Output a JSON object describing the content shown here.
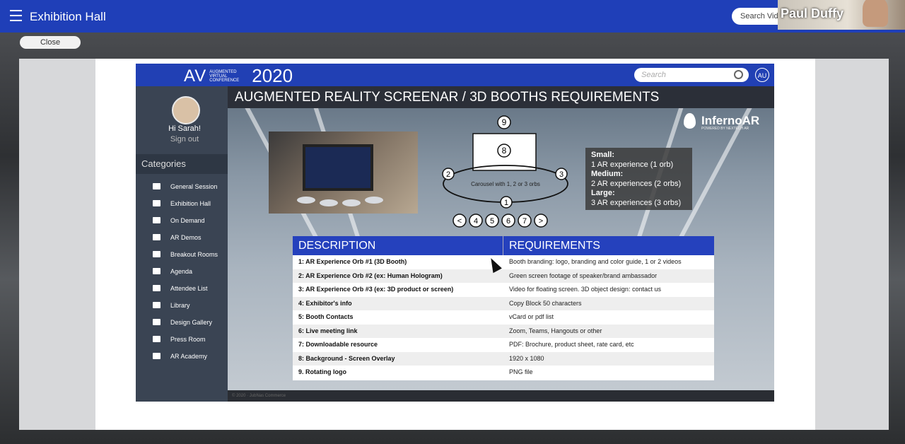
{
  "topbar": {
    "title": "Exhibition Hall",
    "search_placeholder": "Search Vid"
  },
  "camera": {
    "name": "Paul Duffy"
  },
  "close_label": "Close",
  "inner": {
    "logo_av": "AV",
    "logo_small": "AUGMENTED VIRTUAL CONFERENCE",
    "logo_year": "2020",
    "search_placeholder": "Search",
    "avatar_initials": "AU",
    "greeting": "Hi Sarah!",
    "signout": "Sign out",
    "categories_label": "Categories",
    "nav": [
      {
        "label": "General Session",
        "icon": "person-icon"
      },
      {
        "label": "Exhibition Hall",
        "icon": "booth-icon"
      },
      {
        "label": "On Demand",
        "icon": "screen-icon"
      },
      {
        "label": "AR Demos",
        "icon": "headset-icon"
      },
      {
        "label": "Breakout Rooms",
        "icon": "group-icon"
      },
      {
        "label": "Agenda",
        "icon": "calendar-icon"
      },
      {
        "label": "Attendee List",
        "icon": "id-card-icon"
      },
      {
        "label": "Library",
        "icon": "books-icon"
      },
      {
        "label": "Design Gallery",
        "icon": "palette-icon"
      },
      {
        "label": "Press Room",
        "icon": "news-icon"
      },
      {
        "label": "AR Academy",
        "icon": "graduation-cap-icon"
      }
    ],
    "stage_title": "AUGMENTED REALITY SCREENAR / 3D BOOTHS REQUIREMENTS",
    "footer": "© 2020 · JubNas Commerce",
    "inferno": {
      "name": "InfernoAR",
      "sub": "POWERED BY NEXTECH AR"
    },
    "diagram": {
      "n9": "9",
      "n8": "8",
      "n2": "2",
      "n3": "3",
      "n1": "1",
      "carousel": "Carousel with 1, 2 or 3 orbs",
      "nav": [
        "<",
        "4",
        "5",
        "6",
        "7",
        ">"
      ]
    },
    "legend": {
      "small_label": "Small:",
      "small_text": "1 AR experience (1 orb)",
      "medium_label": "Medium:",
      "medium_text": "2 AR experiences (2 orbs)",
      "large_label": "Large:",
      "large_text": "3 AR experiences (3 orbs)"
    },
    "table": {
      "headers": [
        "DESCRIPTION",
        "REQUIREMENTS"
      ],
      "rows": [
        [
          "1: AR Experience Orb #1 (3D Booth)",
          "Booth branding: logo, branding and color guide, 1 or 2 videos"
        ],
        [
          "2: AR Experience Orb #2 (ex: Human Hologram)",
          "Green screen footage of speaker/brand ambassador"
        ],
        [
          "3: AR Experience Orb #3 (ex: 3D product or screen)",
          "Video for floating screen. 3D object design: contact us"
        ],
        [
          "4: Exhibitor's info",
          "Copy Block 50 characters"
        ],
        [
          "5: Booth Contacts",
          "vCard or pdf list"
        ],
        [
          "6: Live meeting link",
          "Zoom, Teams, Hangouts or other"
        ],
        [
          "7: Downloadable resource",
          "PDF: Brochure, product sheet, rate card, etc"
        ],
        [
          "8: Background - Screen Overlay",
          "1920 x 1080"
        ],
        [
          "9. Rotating logo",
          "PNG file"
        ]
      ]
    }
  }
}
